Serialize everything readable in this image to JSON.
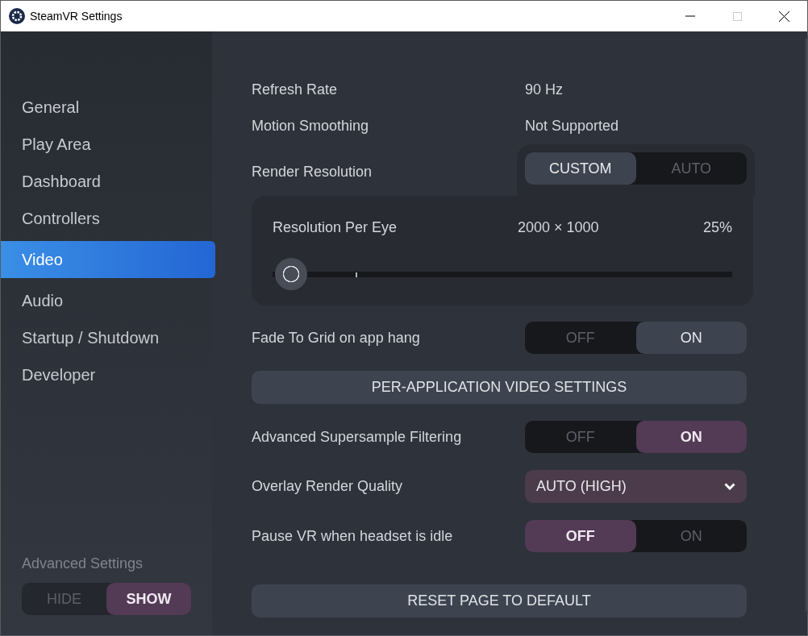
{
  "window": {
    "title": "SteamVR Settings"
  },
  "sidebar": {
    "items": [
      {
        "label": "General",
        "selected": false
      },
      {
        "label": "Play Area",
        "selected": false
      },
      {
        "label": "Dashboard",
        "selected": false
      },
      {
        "label": "Controllers",
        "selected": false
      },
      {
        "label": "Video",
        "selected": true
      },
      {
        "label": "Audio",
        "selected": false
      },
      {
        "label": "Startup / Shutdown",
        "selected": false
      },
      {
        "label": "Developer",
        "selected": false
      }
    ],
    "advanced_settings": {
      "label": "Advanced Settings",
      "modified": true,
      "options": [
        {
          "label": "HIDE",
          "selected": false
        },
        {
          "label": "SHOW",
          "selected": true
        }
      ]
    }
  },
  "settings": [
    {
      "kind": "info",
      "label": "Refresh Rate",
      "value": "90 Hz"
    },
    {
      "kind": "info",
      "label": "Motion Smoothing",
      "value": "Not Supported"
    },
    {
      "kind": "resolution",
      "label": "Render Resolution",
      "modified": false,
      "options": [
        {
          "label": "CUSTOM",
          "selected": true
        },
        {
          "label": "AUTO",
          "selected": false
        }
      ],
      "slider": {
        "label": "Resolution Per Eye",
        "value": "2000 × 1000",
        "reading": "25%",
        "level": 0.04
      }
    },
    {
      "kind": "toggle",
      "label": "Fade To Grid on app hang",
      "modified": false,
      "options": [
        {
          "label": "OFF",
          "selected": false
        },
        {
          "label": "ON",
          "selected": true
        }
      ]
    },
    {
      "kind": "button",
      "label": "PER-APPLICATION VIDEO SETTINGS"
    },
    {
      "kind": "toggle",
      "label": "Advanced Supersample Filtering",
      "modified": true,
      "options": [
        {
          "label": "OFF",
          "selected": false
        },
        {
          "label": "ON",
          "selected": true
        }
      ]
    },
    {
      "kind": "dropdown",
      "label": "Overlay Render Quality",
      "value": "AUTO (HIGH)",
      "modified": true
    },
    {
      "kind": "toggle",
      "label": "Pause VR when headset is idle",
      "modified": true,
      "options": [
        {
          "label": "OFF",
          "selected": true
        },
        {
          "label": "ON",
          "selected": false
        }
      ]
    },
    {
      "kind": "spacer"
    },
    {
      "kind": "button",
      "label": "RESET PAGE TO DEFAULT"
    }
  ]
}
